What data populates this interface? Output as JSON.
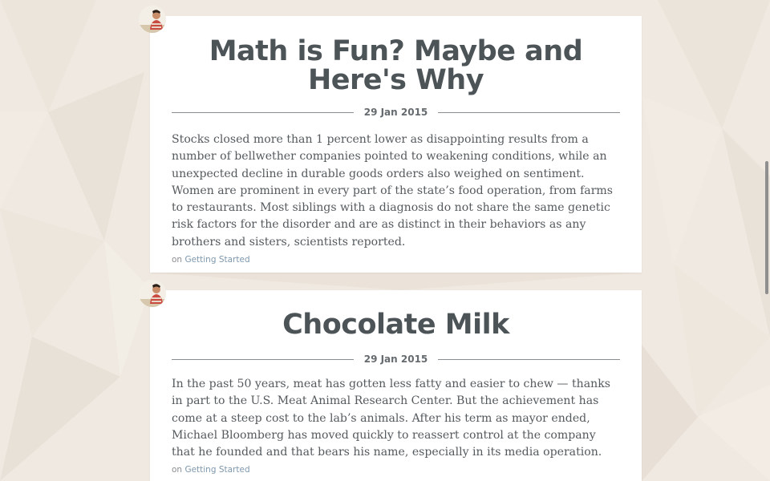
{
  "posts": [
    {
      "title": "Math is Fun? Maybe and Here's Why",
      "date": "29 Jan 2015",
      "excerpt": "Stocks closed more than 1 percent lower as disappointing results from a number of bellwether companies pointed to weakening conditions, while an unexpected decline in durable goods orders also weighed on sentiment. Women are prominent in every part of the state’s food operation, from farms to restaurants. Most siblings with a diagnosis do not share the same genetic risk factors for the disorder and are as distinct in their behaviors as any brothers and sisters, scientists reported.",
      "category_prefix": "on",
      "category": "Getting Started"
    },
    {
      "title": "Chocolate Milk",
      "date": "29 Jan 2015",
      "excerpt": "In the past 50 years, meat has gotten less fatty and easier to chew — thanks in part to the U.S. Meat Animal Research Center. But the achievement has come at a steep cost to the lab’s animals. After his term as mayor ended, Michael Bloomberg has moved quickly to reassert control at the company that he founded and that bears his name, especially in its media operation.",
      "category_prefix": "on",
      "category": "Getting Started"
    }
  ],
  "colors": {
    "background": "#efe9e1",
    "card": "#ffffff",
    "title": "#4d5458",
    "body_text": "#555a5e",
    "link": "#7f98ad"
  },
  "icons": {
    "avatar": "author-avatar"
  }
}
